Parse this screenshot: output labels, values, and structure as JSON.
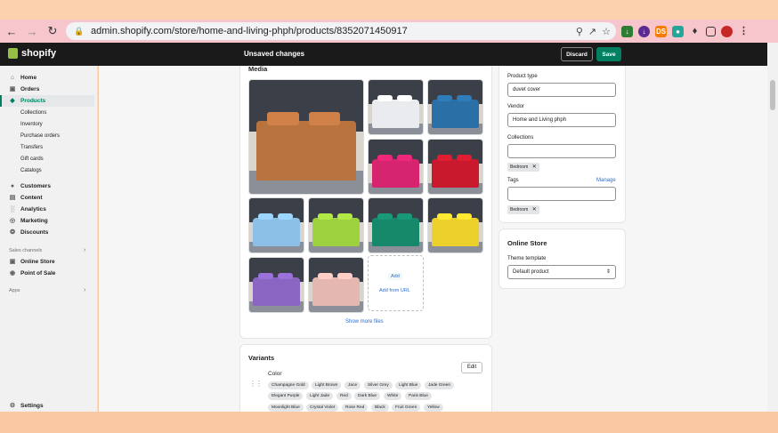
{
  "browser": {
    "url": "admin.shopify.com/store/home-and-living-phph/products/8352071450917",
    "ext_ds_label": "DS"
  },
  "topbar": {
    "logo_text": "shopify",
    "title": "Unsaved changes",
    "discard_label": "Discard",
    "save_label": "Save"
  },
  "sidebar": {
    "items": [
      {
        "label": "Home",
        "icon": "home-icon"
      },
      {
        "label": "Orders",
        "icon": "orders-icon"
      },
      {
        "label": "Products",
        "icon": "tag-icon"
      },
      {
        "label": "Customers",
        "icon": "person-icon"
      },
      {
        "label": "Content",
        "icon": "content-icon"
      },
      {
        "label": "Analytics",
        "icon": "bar-chart-icon"
      },
      {
        "label": "Marketing",
        "icon": "target-icon"
      },
      {
        "label": "Discounts",
        "icon": "discount-icon"
      }
    ],
    "product_sub": [
      "Collections",
      "Inventory",
      "Purchase orders",
      "Transfers",
      "Gift cards",
      "Catalogs"
    ],
    "sales_channels_label": "Sales channels",
    "channels": [
      "Online Store",
      "Point of Sale"
    ],
    "apps_label": "Apps",
    "settings_label": "Settings"
  },
  "media": {
    "title": "Media",
    "images": [
      {
        "name": "Champagne Gold",
        "color": "#b9733f"
      },
      {
        "name": "White",
        "color": "#e9ebee"
      },
      {
        "name": "Dark Blue",
        "color": "#2a6fa6"
      },
      {
        "name": "Rose Red",
        "color": "#d6246e"
      },
      {
        "name": "Red",
        "color": "#c81a2c"
      },
      {
        "name": "Light Blue",
        "color": "#8cc0e6"
      },
      {
        "name": "Fruit Green",
        "color": "#9ed13e"
      },
      {
        "name": "Dark Green",
        "color": "#17896b"
      },
      {
        "name": "Yellow",
        "color": "#ecd02c"
      },
      {
        "name": "Purple",
        "color": "#8a66c2"
      },
      {
        "name": "Pink",
        "color": "#e4b8b1"
      }
    ],
    "add_label": "Add",
    "add_from_url_label": "Add from URL",
    "show_more_label": "Show more files"
  },
  "organization": {
    "product_type_label": "Product type",
    "product_type_value": "duvet cover",
    "vendor_label": "Vendor",
    "vendor_value": "Home and Living phph",
    "collections_label": "Collections",
    "collections_value": "",
    "collection_tag": "Bedroom",
    "tags_label": "Tags",
    "manage_label": "Manage",
    "tags_value": "",
    "tag": "Bedroom"
  },
  "online_store": {
    "title": "Online Store",
    "theme_label": "Theme template",
    "theme_value": "Default product"
  },
  "variants": {
    "title": "Variants",
    "option_name": "Color",
    "edit_label": "Edit",
    "values": [
      "Champagne Gold",
      "Light Brown",
      "Jace",
      "Silver Grey",
      "Light Blue",
      "Jade Green",
      "Elegant Purple",
      "Light Jade",
      "Red",
      "Dark Blue",
      "White",
      "Paris Blue",
      "Moonlight Blue",
      "Crystal Violet",
      "Rose Red",
      "Black",
      "Fruit Green",
      "Yellow"
    ]
  }
}
